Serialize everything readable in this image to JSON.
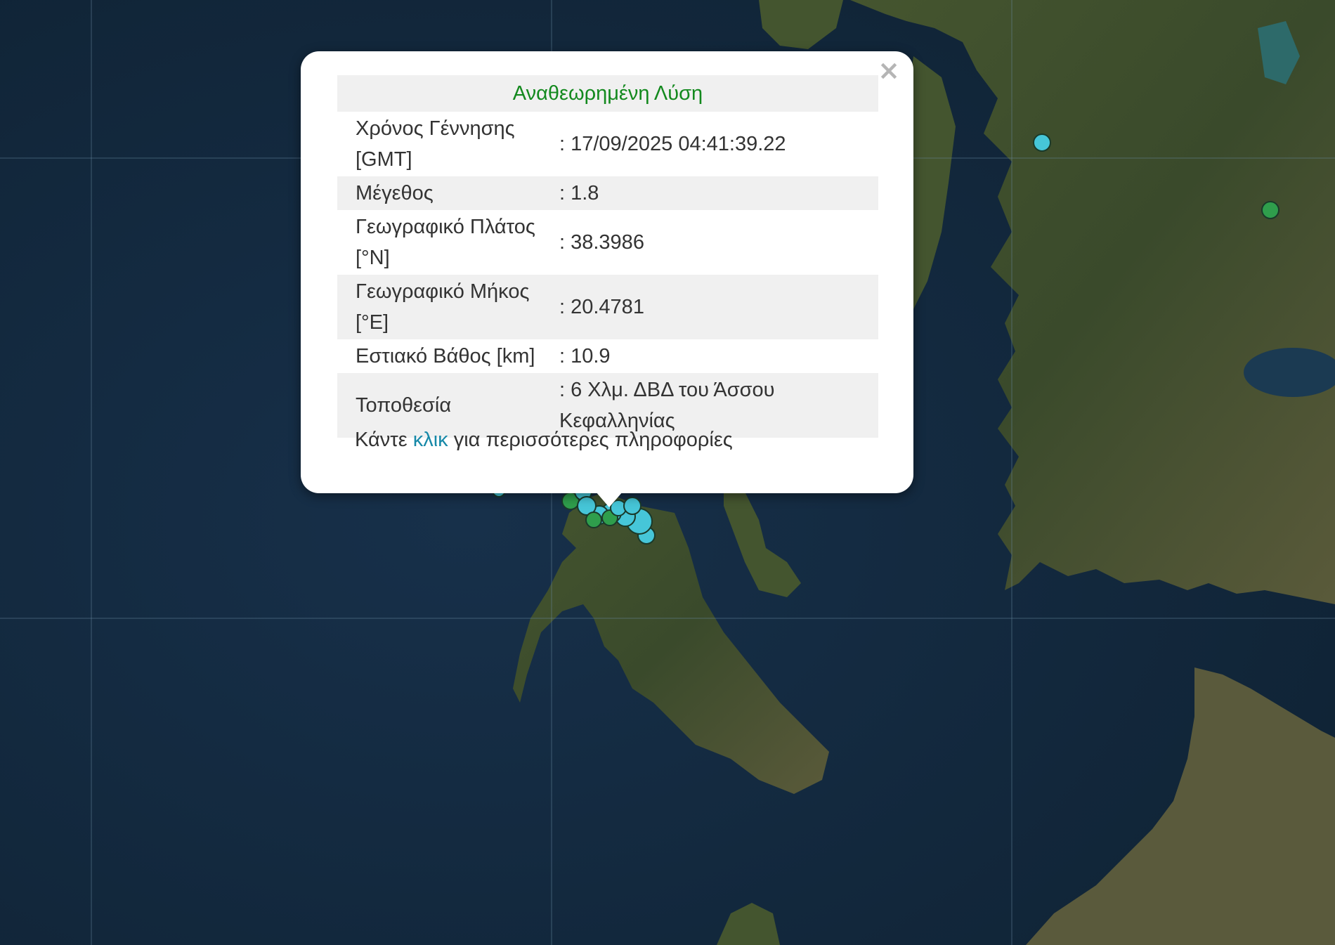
{
  "popup": {
    "title": "Αναθεωρημένη Λύση",
    "rows": [
      {
        "label": "Χρόνος Γέννησης [GMT]",
        "value": ": 17/09/2025 04:41:39.22"
      },
      {
        "label": "Μέγεθος",
        "value": ": 1.8"
      },
      {
        "label": "Γεωγραφικό Πλάτος [°N]",
        "value": ": 38.3986"
      },
      {
        "label": "Γεωγραφικό Μήκος [°E]",
        "value": ": 20.4781"
      },
      {
        "label": "Εστιακό Βάθος [km]",
        "value": ": 10.9"
      },
      {
        "label": "Τοποθεσία",
        "value": ": 6 Χλμ. ΔΒΔ του Άσσου Κεφαλληνίας"
      }
    ],
    "more_prefix": "Κάντε",
    "more_link": "κλικ",
    "more_suffix": "για περισσότερες πληροφορίες",
    "close_icon": "close-icon"
  },
  "colors": {
    "sea": "#142a3e",
    "land": "#3b4a2a",
    "marker_cyan": "#46c6d8",
    "marker_green": "#2f9e4c",
    "title_green": "#13891e",
    "link_blue": "#1789a8"
  }
}
